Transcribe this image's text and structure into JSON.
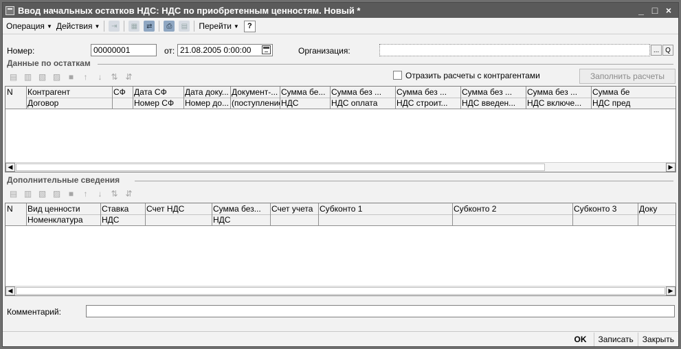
{
  "window": {
    "title": "Ввод начальных остатков НДС: НДС по приобретенным ценностям. Новый *",
    "controls": [
      "_",
      "□",
      "×"
    ]
  },
  "menubar": {
    "operation": "Операция",
    "actions": "Действия",
    "goto": "Перейти",
    "help": "?"
  },
  "header": {
    "number_label": "Номер:",
    "number_value": "00000001",
    "from_label": "от:",
    "date_value": "21.08.2005 0:00:00",
    "org_label": "Организация:",
    "org_value": "",
    "org_select": "...",
    "org_open": "Q"
  },
  "balances": {
    "title": "Данные по остаткам",
    "checkbox_label": "Отразить расчеты с контрагентами",
    "fill_button": "Заполнить расчеты",
    "columns_top": [
      "N",
      "Контрагент",
      "СФ",
      "Дата СФ",
      "Дата доку...",
      "Документ-...",
      "Сумма бе...",
      "Сумма без ...",
      "Сумма без ...",
      "Сумма без ...",
      "Сумма без ...",
      "Сумма бе"
    ],
    "columns_bottom": [
      "",
      "Договор",
      "",
      "Номер СФ",
      "Номер до...",
      "(поступление",
      "НДС",
      "НДС оплата",
      "НДС строит...",
      "НДС введен...",
      "НДС включе...",
      "НДС пред"
    ]
  },
  "additional": {
    "title": "Дополнительные сведения",
    "columns_top": [
      "N",
      "Вид ценности",
      "Ставка",
      "Счет НДС",
      "Сумма без...",
      "Счет учета",
      "Субконто 1",
      "Субконто 2",
      "Субконто 3",
      "Доку"
    ],
    "columns_bottom": [
      "",
      "Номенклатура",
      "НДС",
      "",
      "НДС",
      "",
      "",
      "",
      "",
      ""
    ]
  },
  "comment": {
    "label": "Комментарий:",
    "value": ""
  },
  "footer": {
    "ok": "OK",
    "save": "Записать",
    "close": "Закрыть"
  },
  "icons": {
    "toolbar": [
      "new-row-icon",
      "copy-icon",
      "save-icon",
      "refresh-icon",
      "move-up-icon",
      "move-down-icon",
      "sort-asc-icon",
      "sort-desc-icon"
    ]
  }
}
